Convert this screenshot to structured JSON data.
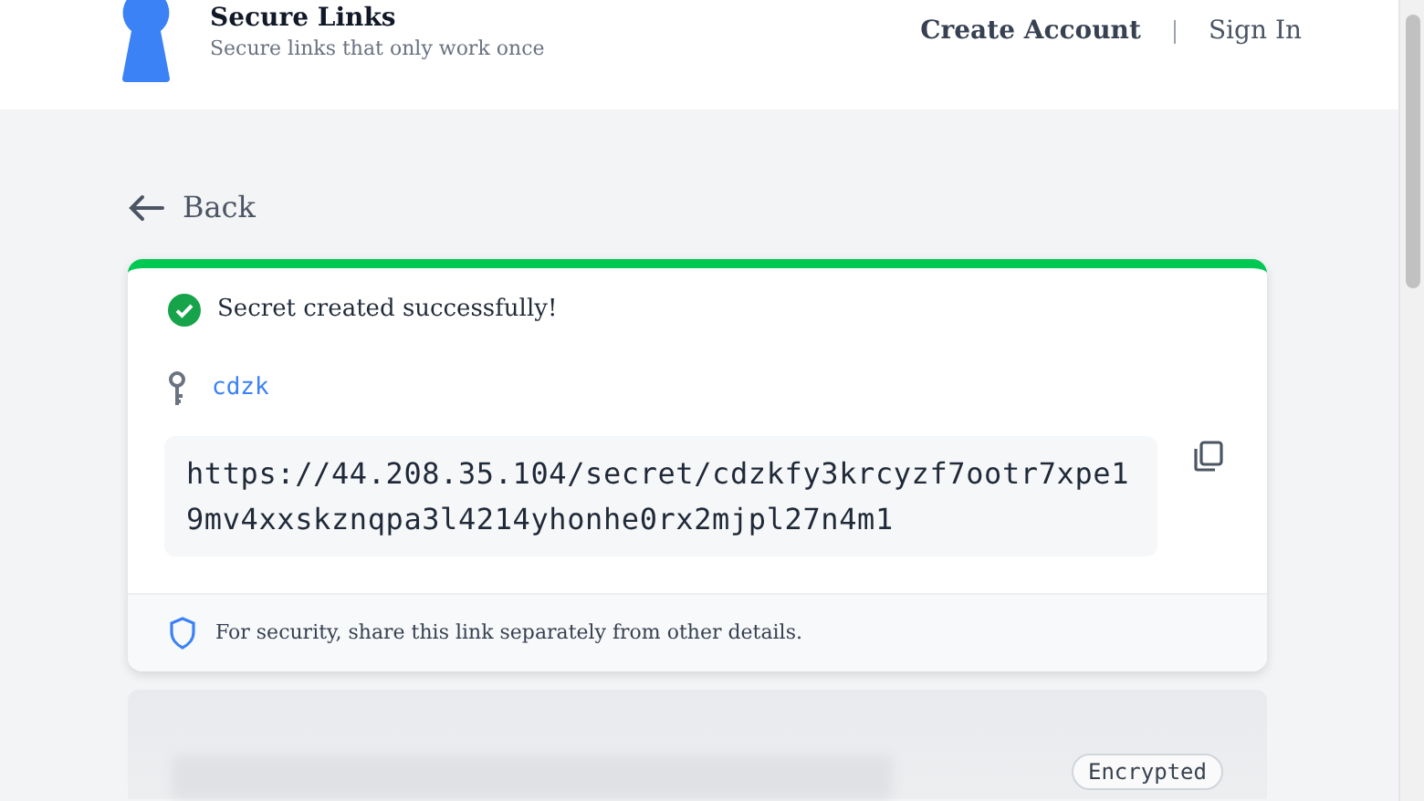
{
  "header": {
    "title": "Secure Links",
    "tagline": "Secure links that only work once",
    "nav": [
      {
        "label": "Create Account",
        "bold": true
      },
      {
        "label": "Sign In",
        "bold": false
      }
    ]
  },
  "back": {
    "label": "Back"
  },
  "result": {
    "message": "Secret created successfully!",
    "name": "cdzk",
    "url": "https://44.208.35.104/secret/cdzkfy3krcyzf7ootr7xpe19mv4xxskznqpa3l4214yhonhe0rx2mjpl27n4m1",
    "note": "For security, share this link separately from other details."
  },
  "preview": {
    "badge": "Encrypted"
  }
}
